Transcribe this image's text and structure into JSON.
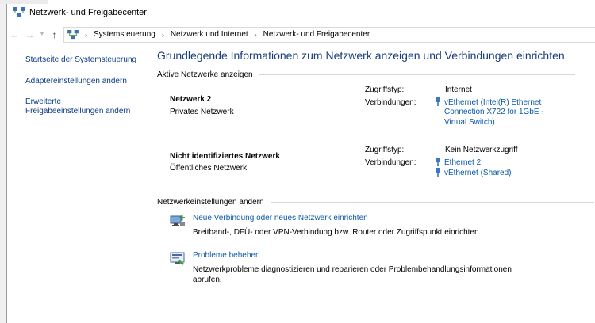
{
  "window": {
    "title": "Netzwerk- und Freigabecenter"
  },
  "address": {
    "crumbs": [
      "Systemsteuerung",
      "Netzwerk und Internet",
      "Netzwerk- und Freigabecenter"
    ]
  },
  "sidebar": {
    "links": [
      "Startseite der Systemsteuerung",
      "Adaptereinstellungen ändern",
      "Erweiterte",
      "Freigabeeinstellungen ändern"
    ]
  },
  "main": {
    "title": "Grundlegende Informationen zum Netzwerk anzeigen und Verbindungen einrichten",
    "active_section": "Aktive Netzwerke anzeigen",
    "networks": [
      {
        "name": "Netzwerk  2",
        "type": "Privates Netzwerk",
        "access_label": "Zugriffstyp:",
        "access_value": "Internet",
        "conn_label": "Verbindungen:",
        "connections": [
          "vEthernet (Intel(R) Ethernet",
          "Connection X722 for 1GbE -",
          "Virtual Switch)"
        ]
      },
      {
        "name": "Nicht identifiziertes Netzwerk",
        "type": "Öffentliches Netzwerk",
        "access_label": "Zugriffstyp:",
        "access_value": "Kein Netzwerkzugriff",
        "conn_label": "Verbindungen:",
        "connections": [
          "Ethernet 2",
          "vEthernet (Shared)"
        ]
      }
    ],
    "settings_section": "Netzwerkeinstellungen ändern",
    "tasks": [
      {
        "title": "Neue Verbindung oder neues Netzwerk einrichten",
        "desc": [
          "Breitband-, DFÜ- oder VPN-Verbindung bzw. Router oder Zugriffspunkt einrichten."
        ]
      },
      {
        "title": "Probleme beheben",
        "desc": [
          "Netzwerkprobleme diagnostizieren und reparieren oder Problembehandlungsinformationen",
          "abrufen."
        ]
      }
    ]
  },
  "icons": {
    "back": "arrow-left-icon",
    "forward": "arrow-right-icon",
    "recent": "chevron-down-icon",
    "up": "arrow-up-icon",
    "network": "network-center-icon",
    "ethernet": "ethernet-plug-icon",
    "new_connection": "new-connection-icon",
    "troubleshoot": "troubleshoot-icon"
  },
  "colors": {
    "link": "#0c59a8",
    "title": "#1a3e7d",
    "nav_link": "#0c3c82"
  }
}
